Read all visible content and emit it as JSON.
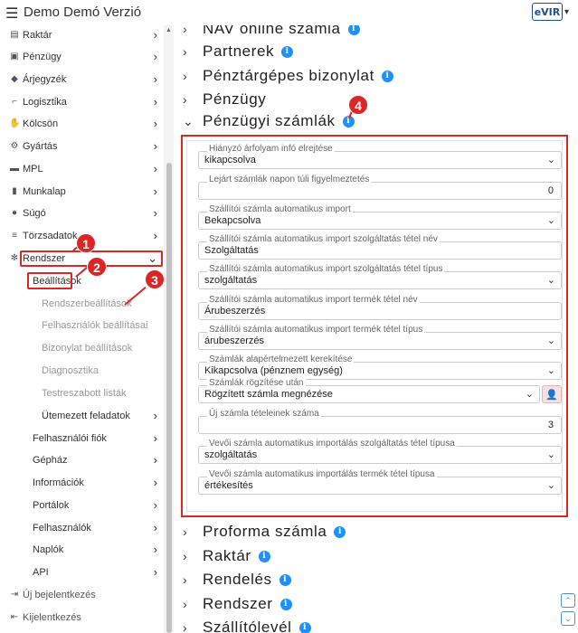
{
  "header": {
    "title": "Demo Demó Verzió",
    "logo_text": "eVIR"
  },
  "sidebar": {
    "items": [
      {
        "label": "Raktár",
        "icon": "warehouse-icon"
      },
      {
        "label": "Pénzügy",
        "icon": "money-icon"
      },
      {
        "label": "Árjegyzék",
        "icon": "tags-icon"
      },
      {
        "label": "Logisztika",
        "icon": "dolly-icon"
      },
      {
        "label": "Kölcsön",
        "icon": "handshake-icon"
      },
      {
        "label": "Gyártás",
        "icon": "cogs-icon"
      },
      {
        "label": "MPL",
        "icon": "truck-icon"
      },
      {
        "label": "Munkalap",
        "icon": "file-icon"
      },
      {
        "label": "Súgó",
        "icon": "question-icon"
      },
      {
        "label": "Törzsadatok",
        "icon": "database-icon"
      },
      {
        "label": "Rendszer",
        "icon": "gears-icon"
      }
    ],
    "rendszer_sub": {
      "beallitasok": "Beállítások",
      "beallitasok_items": [
        "Rendszerbeállítások",
        "Felhasználók beállításai",
        "Bizonylat beállítások",
        "Diagnosztika",
        "Testreszabott listák",
        "Ütemezett feladatok"
      ],
      "others": [
        "Felhasználói fiók",
        "Gépház",
        "Információk",
        "Portálok",
        "Felhasználók",
        "Naplók",
        "API"
      ]
    },
    "footer": [
      {
        "label": "Új bejelentkezés",
        "icon": "login-icon"
      },
      {
        "label": "Kijelentkezés",
        "icon": "logout-icon"
      }
    ]
  },
  "main": {
    "sections_top": [
      "NAV online számla",
      "Partnerek",
      "Pénztárgépes bizonylat",
      "Pénzügy",
      "Pénzügyi számlák"
    ],
    "sections_bottom": [
      "Proforma számla",
      "Raktár",
      "Rendelés",
      "Rendszer",
      "Szállítólevél"
    ],
    "fields": [
      {
        "label": "Hiányzó árfolyam infó elrejtése",
        "value": "kikapcsolva",
        "type": "select"
      },
      {
        "label": "Lejárt számlák napon túli figyelmeztetés",
        "value": "0",
        "type": "number"
      },
      {
        "label": "Szállítói számla automatikus import",
        "value": "Bekapcsolva",
        "type": "select"
      },
      {
        "label": "Szállítói számla automatikus import szolgáltatás tétel név",
        "value": "Szolgáltatás",
        "type": "text"
      },
      {
        "label": "Szállítói számla automatikus import szolgáltatás tétel típus",
        "value": "szolgáltatás",
        "type": "select"
      },
      {
        "label": "Szállítói számla automatikus import termék tétel név",
        "value": "Árubeszerzés",
        "type": "text"
      },
      {
        "label": "Szállítói számla automatikus import termék tétel típus",
        "value": "árubeszerzés",
        "type": "select"
      },
      {
        "label": "Számlák alapértelmezett kerekítése",
        "value": "Kikapcsolva (pénznem egység)",
        "type": "select"
      },
      {
        "label": "Számlák rögzítése után",
        "value": "Rögzített számla megnézése",
        "type": "select-user"
      },
      {
        "label": "Új számla tételeinek száma",
        "value": "3",
        "type": "number"
      },
      {
        "label": "Vevői számla automatikus importálás szolgáltatás tétel típusa",
        "value": "szolgáltatás",
        "type": "select"
      },
      {
        "label": "Vevői számla automatikus importálás termék tétel típusa",
        "value": "értékesítés",
        "type": "select"
      }
    ]
  },
  "callouts": [
    "1",
    "2",
    "3",
    "4"
  ],
  "colors": {
    "accent": "#dc2626",
    "info": "#1e90ff",
    "link": "#4a90d9"
  }
}
